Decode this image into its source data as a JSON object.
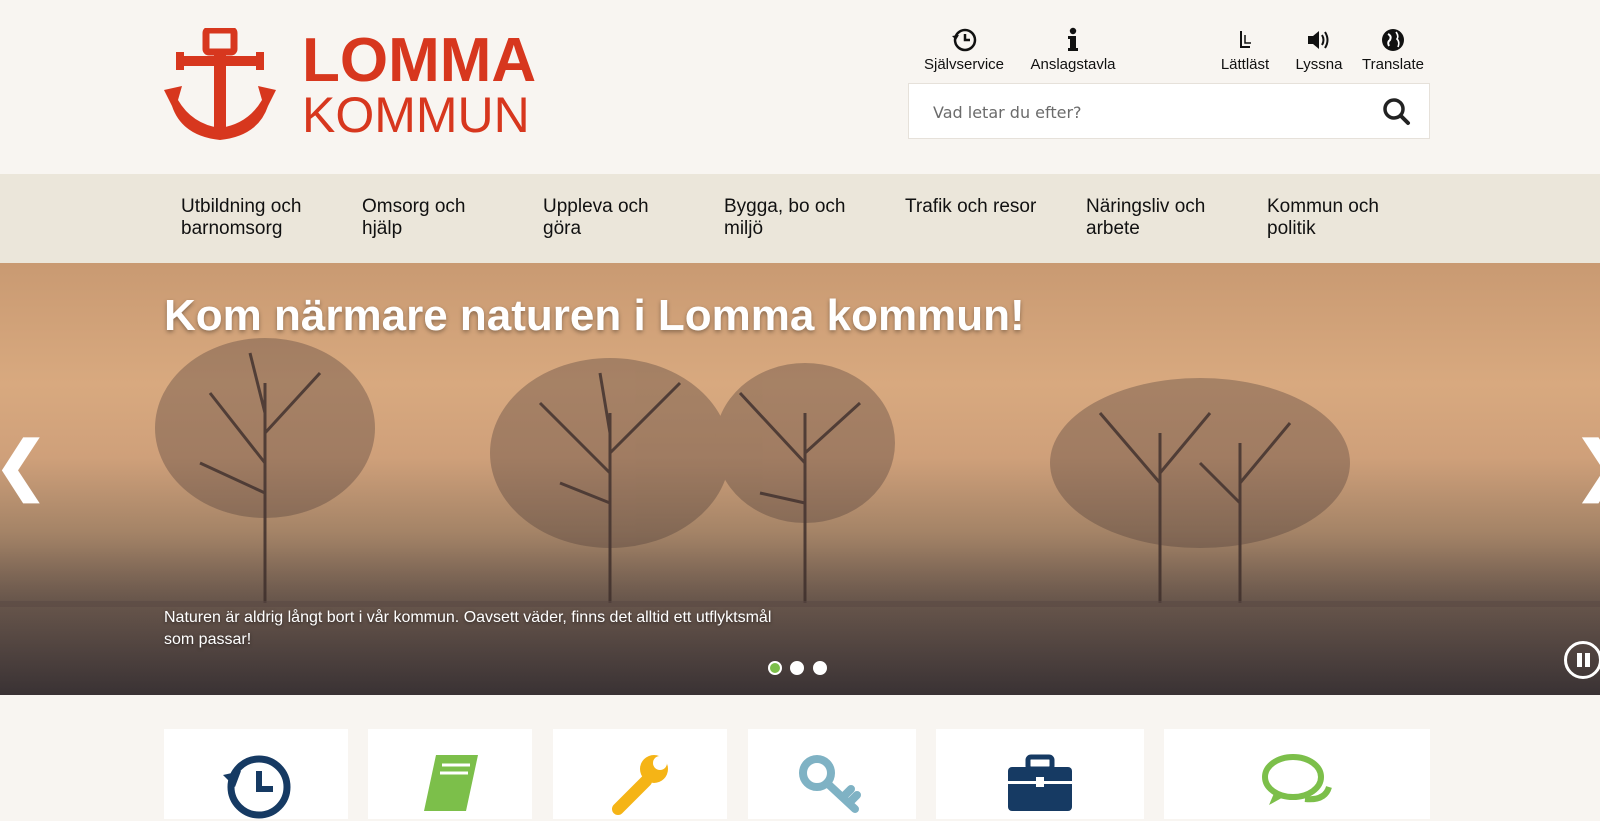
{
  "logo": {
    "line1": "LOMMA",
    "line2": "KOMMUN",
    "color": "#d7371e",
    "icon": "anchor-icon"
  },
  "tools": [
    {
      "label": "Självservice",
      "icon": "clock-24h-icon"
    },
    {
      "label": "Anslagstavla",
      "icon": "info-icon"
    },
    {
      "label": "Lättläst",
      "icon": "easy-read-icon"
    },
    {
      "label": "Lyssna",
      "icon": "speaker-icon"
    },
    {
      "label": "Translate",
      "icon": "globe-icon"
    }
  ],
  "search": {
    "placeholder": "Vad letar du efter?",
    "icon": "search-icon"
  },
  "nav": [
    {
      "label": "Utbildning och barnomsorg"
    },
    {
      "label": "Omsorg och hjälp"
    },
    {
      "label": "Uppleva och göra"
    },
    {
      "label": "Bygga, bo och miljö"
    },
    {
      "label": "Trafik och resor"
    },
    {
      "label": "Näringsliv och arbete"
    },
    {
      "label": "Kommun och politik"
    }
  ],
  "hero": {
    "title": "Kom närmare naturen i Lomma kommun!",
    "text": "Naturen är aldrig långt bort i vår kommun. Oavsett väder, finns det alltid ett utflyktsmål som passar!",
    "prev": "❮",
    "next": "❯",
    "slide_count": 3,
    "active_slide": 1,
    "accent": "#7cbf4a"
  },
  "cards": [
    {
      "icon": "clock-24h-icon",
      "color": "#163a63"
    },
    {
      "icon": "book-icon",
      "color": "#7cbf4a"
    },
    {
      "icon": "wrench-icon",
      "color": "#f5b416"
    },
    {
      "icon": "key-icon",
      "color": "#7fb2c4"
    },
    {
      "icon": "briefcase-icon",
      "color": "#163a63"
    },
    {
      "icon": "chat-icon",
      "color": "#7cbf4a"
    }
  ]
}
